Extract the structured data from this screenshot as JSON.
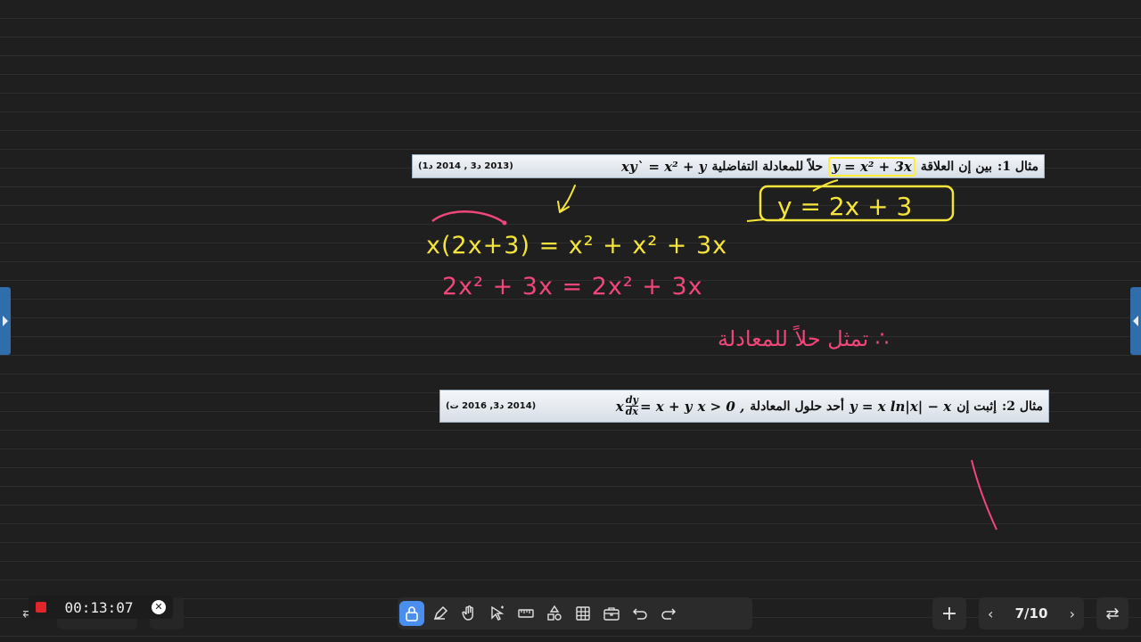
{
  "example1": {
    "label": "مثال 1:",
    "text_a": "بين إن العلاقة",
    "relation": "y = x² + 3x",
    "text_b": "حلاً للمعادلة التفاضلية",
    "equation": "xy` = x² + y",
    "reference": "(2013 د3 , 2014 د1)"
  },
  "example2": {
    "label": "مثال 2:",
    "text_a": "إثبت إن",
    "relation": "y = x ln|x| − x",
    "text_b": "أحد حلول المعادلة",
    "condition": "x > 0 ,",
    "equation_lhs": "x",
    "frac_num": "dy",
    "frac_den": "dx",
    "equation_rhs": "= x + y",
    "reference": "(2014 د3, 2016 ت)"
  },
  "handwriting": {
    "derivative": "y = 2x + 3",
    "line1": "x(2x+3) = x² + x² + 3x",
    "line2": "2x² + 3x = 2x² + 3x",
    "conclusion": "∴ تمثل حلاً للمعادلة"
  },
  "colors": {
    "yellow_ink": "#f5e43a",
    "pink_ink": "#f0467a",
    "accent": "#4a8ff0"
  },
  "recorder": {
    "timer": "00:13:07",
    "status": "recording"
  },
  "toolbar": {
    "tools": [
      "lock-icon",
      "pen-icon",
      "hand-icon",
      "select-icon",
      "ruler-icon",
      "shapes-icon",
      "table-icon",
      "toolbox-icon",
      "undo-icon",
      "redo-icon"
    ],
    "active": "lock-icon"
  },
  "pager": {
    "page": "7/10",
    "prev": "‹",
    "next": "›",
    "add": "+"
  }
}
